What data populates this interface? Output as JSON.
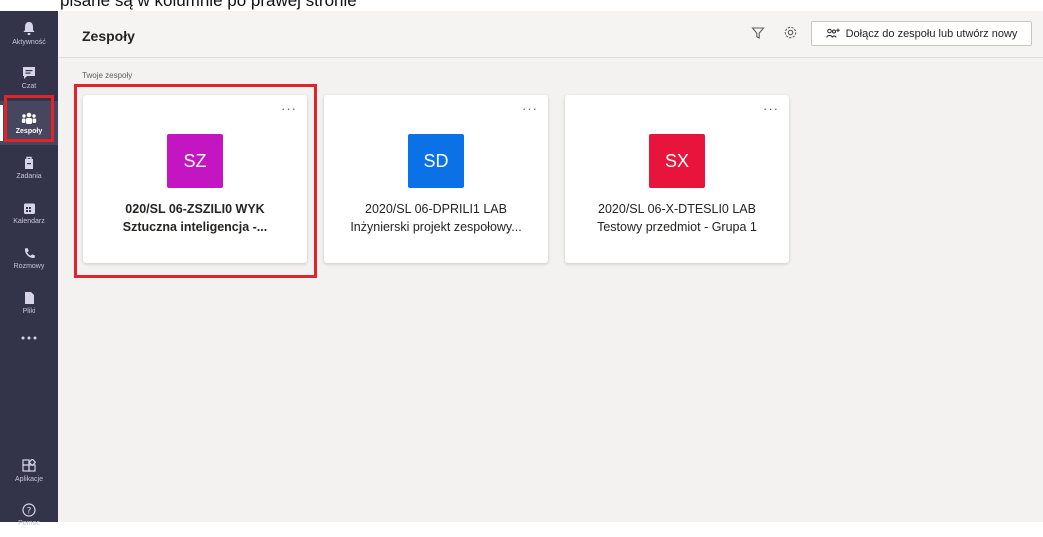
{
  "top_caption": "pisane są w kolumnie po prawej stronie",
  "rail": {
    "items": [
      {
        "label": "Aktywność",
        "icon": "bell-icon"
      },
      {
        "label": "Czat",
        "icon": "chat-icon"
      },
      {
        "label": "Zespoły",
        "icon": "teams-icon"
      },
      {
        "label": "Zadania",
        "icon": "assignments-icon"
      },
      {
        "label": "Kalendarz",
        "icon": "calendar-icon"
      },
      {
        "label": "Rozmowy",
        "icon": "phone-icon"
      },
      {
        "label": "Pliki",
        "icon": "file-icon"
      },
      {
        "label": "",
        "icon": "more-icon"
      }
    ],
    "bottom": [
      {
        "label": "Aplikacje",
        "icon": "apps-icon"
      },
      {
        "label": "Pomoc",
        "icon": "help-icon"
      }
    ],
    "active": "Zespoły"
  },
  "header": {
    "title": "Zespoły",
    "join_button": "Dołącz do zespołu lub utwórz nowy"
  },
  "section_label": "Twoje zespoły",
  "teams": [
    {
      "initials": "SZ",
      "color": "#c316c2",
      "name": "020/SL 06-ZSZILI0 WYK",
      "description": "Sztuczna inteligencja -...",
      "more": "···"
    },
    {
      "initials": "SD",
      "color": "#0a72e6",
      "name": "2020/SL 06-DPRILI1 LAB",
      "description": "Inżynierski projekt zespołowy...",
      "more": "···"
    },
    {
      "initials": "SX",
      "color": "#e8143c",
      "name": "2020/SL 06-X-DTESLI0 LAB",
      "description": "Testowy przedmiot - Grupa 1",
      "more": "···"
    }
  ],
  "colors": {
    "rail": "#33344a",
    "highlight": "#e0242a",
    "background": "#f3f2f1"
  }
}
